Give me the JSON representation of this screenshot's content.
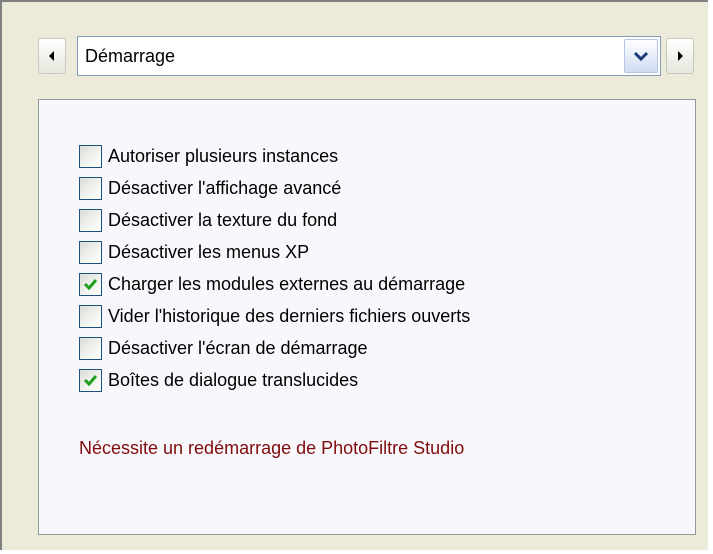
{
  "navigation": {
    "prev_icon": "arrow-left-icon",
    "next_icon": "arrow-right-icon"
  },
  "category_select": {
    "selected": "Démarrage",
    "dropdown_icon": "chevron-down-icon"
  },
  "options": [
    {
      "label": "Autoriser plusieurs instances",
      "checked": false
    },
    {
      "label": "Désactiver l'affichage avancé",
      "checked": false
    },
    {
      "label": "Désactiver la texture du fond",
      "checked": false
    },
    {
      "label": "Désactiver les menus XP",
      "checked": false
    },
    {
      "label": "Charger les modules externes au démarrage",
      "checked": true
    },
    {
      "label": "Vider l'historique des derniers fichiers ouverts",
      "checked": false
    },
    {
      "label": "Désactiver l'écran de démarrage",
      "checked": false
    },
    {
      "label": "Boîtes de dialogue translucides",
      "checked": true
    }
  ],
  "notice": "Nécessite un redémarrage de PhotoFiltre Studio",
  "colors": {
    "dialog_background": "#ecead9",
    "panel_background": "#f8f7fc",
    "checkbox_border": "#1c5180",
    "check_mark": "#21a121",
    "notice_text": "#7f0c0c"
  }
}
